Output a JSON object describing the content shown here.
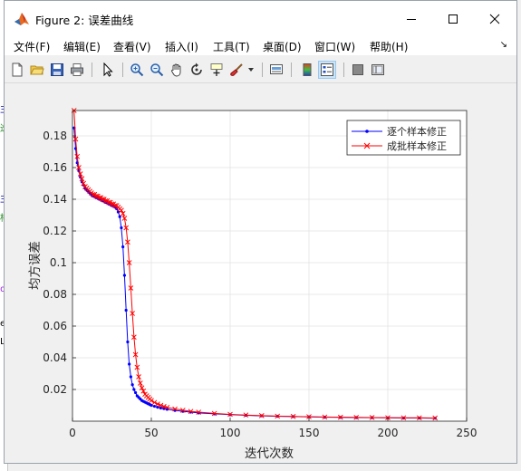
{
  "window": {
    "title": "Figure 2: 误差曲线"
  },
  "menu": [
    "文件(F)",
    "编辑(E)",
    "查看(V)",
    "插入(I)",
    "工具(T)",
    "桌面(D)",
    "窗口(W)",
    "帮助(H)"
  ],
  "toolbar_icons": [
    "new-figure-icon",
    "open-file-icon",
    "save-icon",
    "print-icon",
    "pointer-icon",
    "zoom-in-icon",
    "zoom-out-icon",
    "pan-icon",
    "rotate-3d-icon",
    "data-cursor-icon",
    "brush-icon",
    "brush-dropdown-icon",
    "link-plot-icon",
    "colorbar-icon",
    "legend-icon",
    "hide-plot-tools-icon",
    "show-plot-tools-icon"
  ],
  "bg_fragments": [
    {
      "text": "主",
      "color": "#0000aa",
      "top": 112
    },
    {
      "text": "迭",
      "color": "#228b22",
      "top": 133
    },
    {
      "text": "主",
      "color": "#0000aa",
      "top": 211
    },
    {
      "text": "样",
      "color": "#228b22",
      "top": 232
    },
    {
      "text": "o:",
      "color": "#a020f0",
      "top": 314
    },
    {
      "text": "e",
      "color": "#000000",
      "top": 352
    },
    {
      "text": "Lb",
      "color": "#000000",
      "top": 372
    }
  ],
  "chart_data": {
    "type": "line",
    "xlabel": "迭代次数",
    "ylabel": "均方误差",
    "xlim": [
      0,
      250
    ],
    "ylim": [
      0,
      0.196
    ],
    "xticks": [
      0,
      50,
      100,
      150,
      200,
      250
    ],
    "yticks": [
      0.02,
      0.04,
      0.06,
      0.08,
      0.1,
      0.12,
      0.14,
      0.16,
      0.18
    ],
    "grid": true,
    "legend_position": "top-right",
    "series": [
      {
        "name": "逐个样本修正",
        "color": "#0000ff",
        "marker": "dot",
        "x": [
          1,
          2,
          3,
          4,
          5,
          6,
          7,
          8,
          9,
          10,
          11,
          12,
          13,
          14,
          15,
          16,
          17,
          18,
          19,
          20,
          21,
          22,
          23,
          24,
          25,
          26,
          27,
          28,
          29,
          30,
          31,
          32,
          33,
          34,
          35,
          36,
          37,
          38,
          39,
          40,
          41,
          42,
          43,
          44,
          45,
          46,
          47,
          48,
          49,
          50,
          52,
          54,
          56,
          58,
          60,
          65,
          70,
          75,
          80,
          90,
          100,
          110,
          120,
          130,
          140,
          150,
          160,
          170,
          180,
          190,
          200,
          210,
          220,
          230
        ],
        "y": [
          0.185,
          0.172,
          0.163,
          0.158,
          0.154,
          0.151,
          0.149,
          0.147,
          0.146,
          0.145,
          0.144,
          0.143,
          0.142,
          0.142,
          0.141,
          0.141,
          0.14,
          0.14,
          0.139,
          0.139,
          0.138,
          0.138,
          0.137,
          0.137,
          0.136,
          0.136,
          0.135,
          0.134,
          0.132,
          0.129,
          0.122,
          0.11,
          0.092,
          0.07,
          0.05,
          0.036,
          0.028,
          0.023,
          0.02,
          0.018,
          0.016,
          0.015,
          0.014,
          0.013,
          0.0125,
          0.012,
          0.0115,
          0.011,
          0.0105,
          0.01,
          0.0094,
          0.0088,
          0.0083,
          0.0079,
          0.0075,
          0.0068,
          0.0062,
          0.0057,
          0.0052,
          0.0046,
          0.0041,
          0.0037,
          0.0034,
          0.0031,
          0.0029,
          0.0027,
          0.0025,
          0.0024,
          0.0023,
          0.0022,
          0.0021,
          0.002,
          0.002,
          0.0019
        ]
      },
      {
        "name": "成批样本修正",
        "color": "#ff0000",
        "marker": "x",
        "x": [
          1,
          2,
          3,
          4,
          5,
          6,
          7,
          8,
          9,
          10,
          11,
          12,
          13,
          14,
          15,
          16,
          17,
          18,
          19,
          20,
          21,
          22,
          23,
          24,
          25,
          26,
          27,
          28,
          29,
          30,
          31,
          32,
          33,
          34,
          35,
          36,
          37,
          38,
          39,
          40,
          41,
          42,
          43,
          44,
          45,
          46,
          47,
          48,
          49,
          50,
          52,
          54,
          56,
          58,
          60,
          65,
          70,
          75,
          80,
          90,
          100,
          110,
          120,
          130,
          140,
          150,
          160,
          170,
          180,
          190,
          200,
          210,
          220,
          230
        ],
        "y": [
          0.196,
          0.178,
          0.167,
          0.16,
          0.156,
          0.153,
          0.15,
          0.148,
          0.147,
          0.146,
          0.145,
          0.144,
          0.143,
          0.143,
          0.142,
          0.142,
          0.141,
          0.141,
          0.14,
          0.14,
          0.139,
          0.139,
          0.138,
          0.138,
          0.137,
          0.137,
          0.136,
          0.136,
          0.135,
          0.134,
          0.133,
          0.131,
          0.128,
          0.122,
          0.113,
          0.1,
          0.084,
          0.068,
          0.053,
          0.042,
          0.034,
          0.028,
          0.024,
          0.021,
          0.019,
          0.017,
          0.016,
          0.015,
          0.014,
          0.013,
          0.0118,
          0.0108,
          0.01,
          0.0093,
          0.0087,
          0.0077,
          0.0069,
          0.0062,
          0.0057,
          0.0049,
          0.0043,
          0.0039,
          0.0035,
          0.0032,
          0.003,
          0.0028,
          0.0026,
          0.0025,
          0.0024,
          0.0023,
          0.0022,
          0.0021,
          0.0021,
          0.002
        ]
      }
    ]
  }
}
